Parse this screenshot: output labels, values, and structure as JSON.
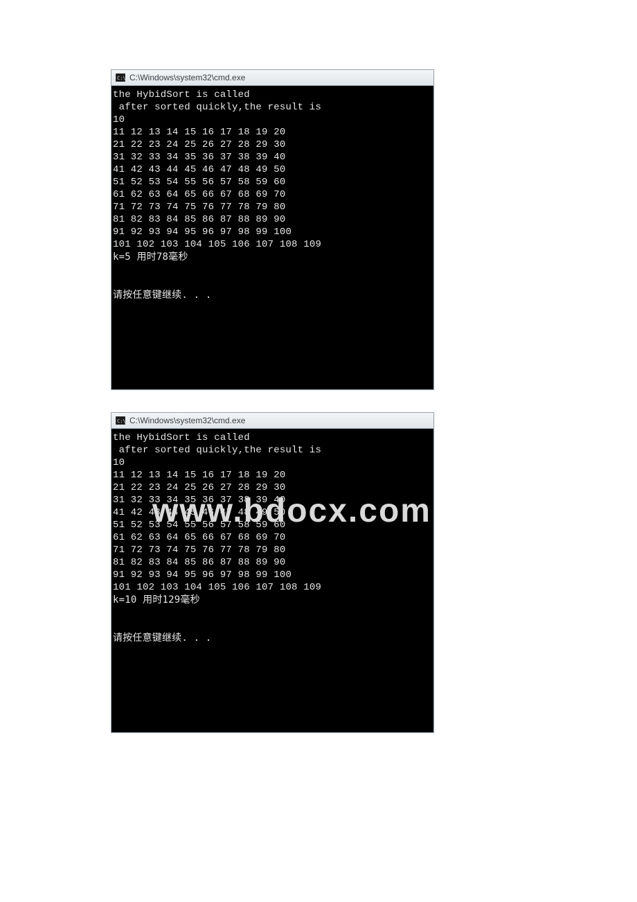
{
  "watermark": "www.bdocx.com",
  "windows": [
    {
      "title": "C:\\Windows\\system32\\cmd.exe",
      "icon": "cmd-icon",
      "lines": [
        "the HybidSort is called",
        " after sorted quickly,the result is",
        "10",
        "11 12 13 14 15 16 17 18 19 20",
        "21 22 23 24 25 26 27 28 29 30",
        "31 32 33 34 35 36 37 38 39 40",
        "41 42 43 44 45 46 47 48 49 50",
        "51 52 53 54 55 56 57 58 59 60",
        "61 62 63 64 65 66 67 68 69 70",
        "71 72 73 74 75 76 77 78 79 80",
        "81 82 83 84 85 86 87 88 89 90",
        "91 92 93 94 95 96 97 98 99 100",
        "101 102 103 104 105 106 107 108 109",
        "k=5 用时78毫秒",
        "",
        "",
        "请按任意键继续. . .",
        "",
        "",
        "",
        "",
        ""
      ]
    },
    {
      "title": "C:\\Windows\\system32\\cmd.exe",
      "icon": "cmd-icon",
      "lines": [
        "the HybidSort is called",
        " after sorted quickly,the result is",
        "10",
        "11 12 13 14 15 16 17 18 19 20",
        "21 22 23 24 25 26 27 28 29 30",
        "31 32 33 34 35 36 37 38 39 40",
        "41 42 43 44 45 46 47 48 49 50",
        "51 52 53 54 55 56 57 58 59 60",
        "61 62 63 64 65 66 67 68 69 70",
        "71 72 73 74 75 76 77 78 79 80",
        "81 82 83 84 85 86 87 88 89 90",
        "91 92 93 94 95 96 97 98 99 100",
        "101 102 103 104 105 106 107 108 109",
        "k=10 用时129毫秒",
        "",
        "",
        "请按任意键继续. . .",
        "",
        "",
        "",
        "",
        ""
      ]
    }
  ]
}
